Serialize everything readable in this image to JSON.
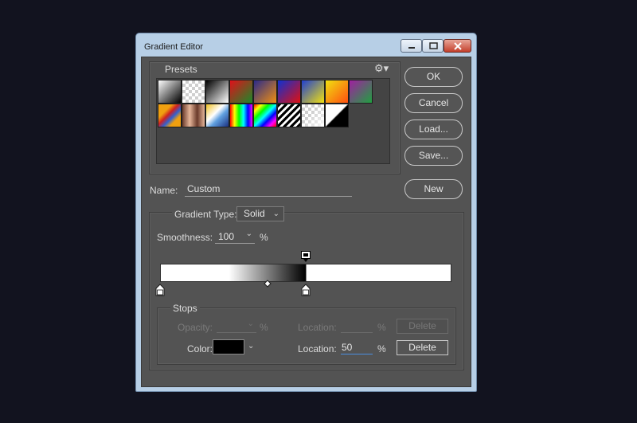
{
  "window": {
    "title": "Gradient Editor"
  },
  "presets": {
    "label": "Presets",
    "gear_icon": "gear-icon",
    "swatches": [
      "linear-gradient(135deg,#ffffff,#000000)",
      "checker",
      "linear-gradient(135deg,#000000,#ffffff)",
      "linear-gradient(135deg,#e0101a,#1a8a2a)",
      "linear-gradient(135deg,#2a2a8a,#f09010)",
      "linear-gradient(135deg,#1030d0,#e01010)",
      "linear-gradient(135deg,#2040d0,#f0e010)",
      "linear-gradient(135deg,#f0e010,#ff5010)",
      "linear-gradient(135deg,#a020a0,#20a040)",
      "linear-gradient(135deg,#f0a010 30%,#d02020 45%,#3060d0 60%,#f0a010 75%)",
      "linear-gradient(90deg,#6a3a2a,#e6b69a,#6a3a2a,#e6b69a)",
      "linear-gradient(135deg,#f0c020,#ffffff 40%,#60a0e0 60%,#1a3080)",
      "linear-gradient(90deg,#ff0000,#ffff00,#00ff00,#00ffff,#0000ff,#ff00ff)",
      "linear-gradient(135deg,#ff0000,#ffff00,#00ff00,#00ffff,#0000ff,#ff00ff,#ff0000)",
      "stripes",
      "checker-fade",
      "linear-gradient(135deg,#ffffff 48%,#000000 52%)"
    ]
  },
  "buttons": {
    "ok": "OK",
    "cancel": "Cancel",
    "load": "Load...",
    "save": "Save...",
    "new": "New"
  },
  "name": {
    "label": "Name:",
    "value": "Custom"
  },
  "gradient": {
    "type_label": "Gradient Type:",
    "type_value": "Solid",
    "smoothness_label": "Smoothness:",
    "smoothness_value": "100",
    "smoothness_unit": "%",
    "color_stops": [
      {
        "location": 0,
        "color": "#ffffff"
      },
      {
        "location": 50,
        "color": "#000000"
      },
      {
        "location": 50,
        "color": "#ffffff"
      }
    ],
    "midpoint_location": 37,
    "opacity_stops": [
      {
        "location": 50,
        "opacity": 100
      }
    ]
  },
  "stops": {
    "label": "Stops",
    "opacity_label": "Opacity:",
    "opacity_unit": "%",
    "opacity_location_label": "Location:",
    "opacity_location_unit": "%",
    "opacity_delete": "Delete",
    "color_label": "Color:",
    "color_value": "#000000",
    "color_location_label": "Location:",
    "color_location_value": "50",
    "color_location_unit": "%",
    "color_delete": "Delete"
  }
}
